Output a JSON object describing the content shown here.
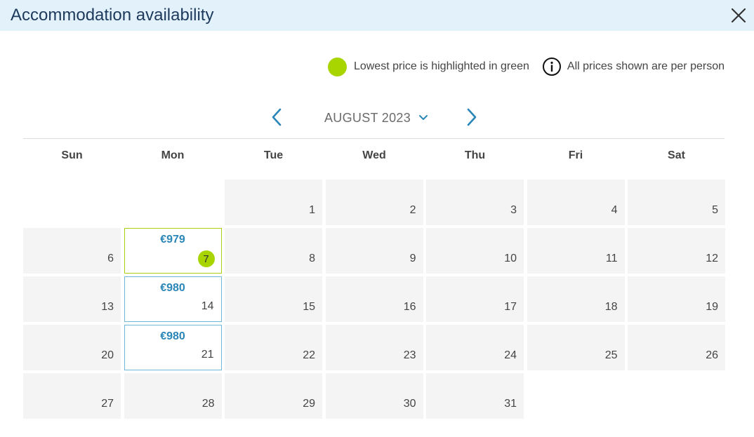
{
  "header": {
    "title": "Accommodation availability"
  },
  "legend": {
    "lowest_text": "Lowest price is highlighted in green",
    "info_text": "All prices shown are per person",
    "lowest_color": "#a8d400"
  },
  "calendar": {
    "month_label": "AUGUST 2023",
    "weekdays": [
      "Sun",
      "Mon",
      "Tue",
      "Wed",
      "Thu",
      "Fri",
      "Sat"
    ],
    "first_weekday_index": 2,
    "days_in_month": 31,
    "prices": {
      "7": {
        "price": "€979",
        "lowest": true
      },
      "14": {
        "price": "€980",
        "lowest": false
      },
      "21": {
        "price": "€980",
        "lowest": false
      }
    }
  },
  "colors": {
    "header_bg": "#e3f1fb",
    "price_text": "#2a86b8",
    "lowest_border": "#a8cf12",
    "priced_border": "#6fb8d8",
    "arrow": "#2a86b8"
  }
}
